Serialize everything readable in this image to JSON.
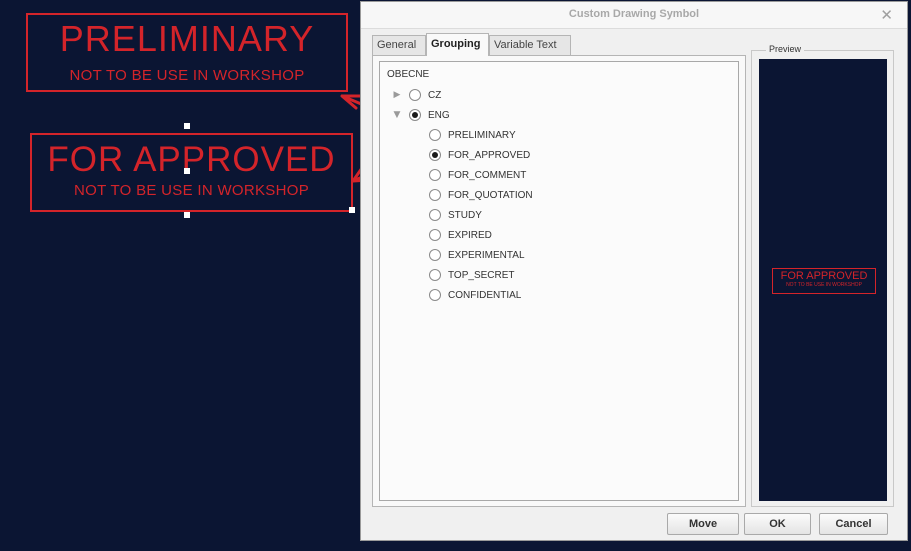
{
  "canvas": {
    "background": "#0b1533",
    "accent": "#d4242a",
    "symbols": [
      {
        "main": "PRELIMINARY",
        "sub": "NOT TO BE USE IN WORKSHOP"
      },
      {
        "main": "FOR APPROVED",
        "sub": "NOT TO BE USE IN WORKSHOP"
      }
    ]
  },
  "dialog": {
    "title": "Custom Drawing Symbol",
    "close_icon": "close-icon",
    "tabs": [
      {
        "label": "General",
        "active": false
      },
      {
        "label": "Grouping",
        "active": true
      },
      {
        "label": "Variable Text",
        "active": false
      }
    ],
    "tree": {
      "root": "OBECNE",
      "groups": [
        {
          "label": "CZ",
          "expander": "▶",
          "selected": false
        },
        {
          "label": "ENG",
          "expander": "▼",
          "selected": true
        }
      ],
      "items": [
        {
          "label": "PRELIMINARY",
          "selected": false
        },
        {
          "label": "FOR_APPROVED",
          "selected": true
        },
        {
          "label": "FOR_COMMENT",
          "selected": false
        },
        {
          "label": "FOR_QUOTATION",
          "selected": false
        },
        {
          "label": "STUDY",
          "selected": false
        },
        {
          "label": "EXPIRED",
          "selected": false
        },
        {
          "label": "EXPERIMENTAL",
          "selected": false
        },
        {
          "label": "TOP_SECRET",
          "selected": false
        },
        {
          "label": "CONFIDENTIAL",
          "selected": false
        }
      ]
    },
    "preview": {
      "legend": "Preview",
      "main": "FOR APPROVED",
      "sub": "NOT TO BE USE IN WORKSHOP"
    },
    "buttons": {
      "move": "Move",
      "ok": "OK",
      "cancel": "Cancel"
    }
  }
}
